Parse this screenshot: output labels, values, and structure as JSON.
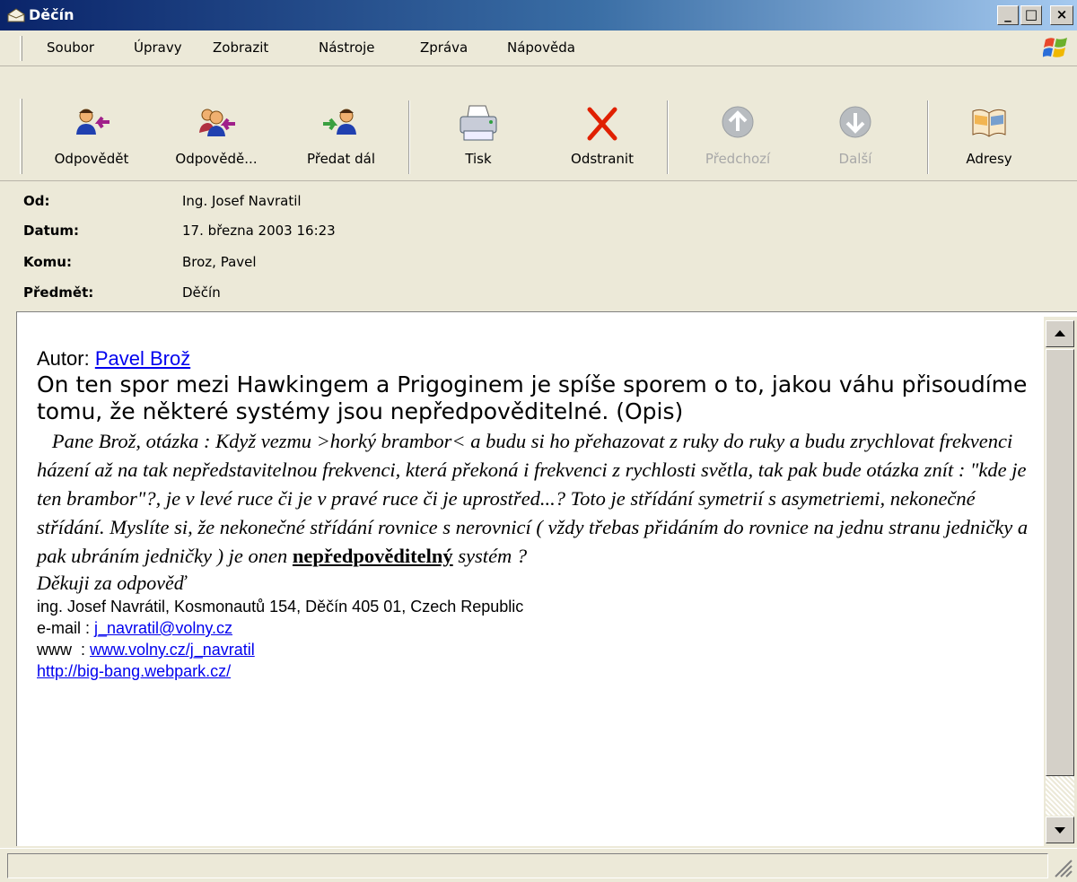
{
  "window": {
    "title": "Děčín",
    "minimize": "_",
    "maximize": "□",
    "close": "×"
  },
  "menu": [
    "Soubor",
    "Úpravy",
    "Zobrazit",
    "Nástroje",
    "Zpráva",
    "Nápověda"
  ],
  "toolbar": {
    "reply": "Odpovědět",
    "reply_all": "Odpovědě...",
    "forward": "Předat dál",
    "print": "Tisk",
    "delete": "Odstranit",
    "previous": "Předchozí",
    "next": "Další",
    "addresses": "Adresy"
  },
  "headers": {
    "from_label": "Od:",
    "from": "Ing. Josef Navratil",
    "date_label": "Datum:",
    "date": "17. března 2003 16:23",
    "to_label": "Komu:",
    "to": "Broz, Pavel",
    "subject_label": "Předmět:",
    "subject": "Děčín"
  },
  "message": {
    "author_label": "Autor: ",
    "author_name": "Pavel Brož",
    "lead": "On ten spor mezi Hawkingem a Prigoginem je spíše sporem o to, jakou váhu přisoudíme tomu, že některé systémy jsou nepředpověditelné. (Opis)",
    "question_before": "   Pane Brož, otázka : Když vezmu >horký brambor< a budu si ho přehazovat z ruky do ruky a budu zrychlovat frekvenci házení až na tak nepředstavitelnou frekvenci, která překoná i frekvenci z rychlosti světla, tak pak bude otázka znít : \"kde je ten brambor\"?, je v levé ruce či je v pravé ruce či je uprostřed...? Toto je střídání symetrií s asymetriemi, nekonečné střídání. Myslíte si, že nekonečné střídání rovnice s nerovnicí ( vždy třebas přidáním do rovnice na jednu stranu jedničky a pak ubráním jedničky ) je onen ",
    "question_bold": "nepředpověditelný",
    "question_after": " systém ?",
    "thanks": "Děkuji za odpověď",
    "sig_address": "ing. Josef Navrátil, Kosmonautů 154, Děčín  405 01, Czech Republic",
    "sig_email_label": "e-mail : ",
    "sig_email": "j_navratil@volny.cz",
    "sig_www_label": "www  : ",
    "sig_www": "www.volny.cz/j_navratil",
    "sig_link": "http://big-bang.webpark.cz/"
  }
}
